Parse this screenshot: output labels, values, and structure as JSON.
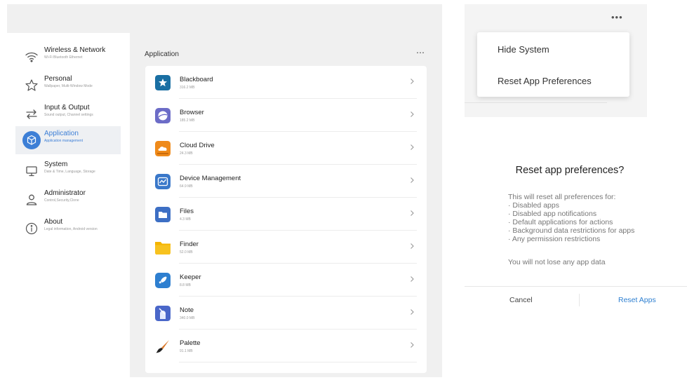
{
  "settings": {
    "sidebar": {
      "items": [
        {
          "title": "Wireless & Network",
          "subtitle": "Wi-Fi Bluetooth Ethernet",
          "icon": "wifi-icon",
          "active": false
        },
        {
          "title": "Personal",
          "subtitle": "Wallpaper, Multi-Window Mode",
          "icon": "star-icon",
          "active": false
        },
        {
          "title": "Input & Output",
          "subtitle": "Sound output, Channel settings",
          "icon": "swap-arrows-icon",
          "active": false
        },
        {
          "title": "Application",
          "subtitle": "Application management",
          "icon": "cube-icon",
          "active": true
        },
        {
          "title": "System",
          "subtitle": "Date & Time, Language, Storage",
          "icon": "monitor-icon",
          "active": false
        },
        {
          "title": "Administrator",
          "subtitle": "Control,Security,Clone",
          "icon": "user-icon",
          "active": false
        },
        {
          "title": "About",
          "subtitle": "Legal information, Android version",
          "icon": "info-icon",
          "active": false
        }
      ]
    },
    "main": {
      "header": "Application",
      "more": "⋯",
      "apps": [
        {
          "name": "Blackboard",
          "size": "316.2 MB",
          "icon": "blackboard-icon",
          "color": "#1a6fa3"
        },
        {
          "name": "Browser",
          "size": "185.2 MB",
          "icon": "browser-icon",
          "color": "#6c6cc7"
        },
        {
          "name": "Cloud Drive",
          "size": "24.3 MB",
          "icon": "cloud-drive-icon",
          "color": "#ef8a1a"
        },
        {
          "name": "Device Management",
          "size": "64.9 MB",
          "icon": "device-management-icon",
          "color": "#3a78c9"
        },
        {
          "name": "Files",
          "size": "4.3 MB",
          "icon": "folder-icon",
          "color": "#3d6fc4"
        },
        {
          "name": "Finder",
          "size": "52.0 MB",
          "icon": "finder-folder-icon",
          "color": "#f4b400"
        },
        {
          "name": "Keeper",
          "size": "8.8 MB",
          "icon": "keeper-icon",
          "color": "#2e7fd0"
        },
        {
          "name": "Note",
          "size": "340.0 MB",
          "icon": "note-icon",
          "color": "#4a67c9"
        },
        {
          "name": "Palette",
          "size": "91.1 MB",
          "icon": "palette-brush-icon",
          "color": "#d9782a"
        }
      ]
    }
  },
  "menu": {
    "more": "•••",
    "items": [
      "Hide System",
      "Reset App Preferences"
    ]
  },
  "dialog": {
    "title": "Reset app preferences?",
    "intro": "This will reset all preferences for:",
    "bullets": [
      "· Disabled apps",
      "· Disabled app notifications",
      "· Default applications for actions",
      "· Background data restrictions for apps",
      "· Any permission restrictions"
    ],
    "note": "You will not lose any app data",
    "cancel": "Cancel",
    "confirm": "Reset Apps"
  }
}
